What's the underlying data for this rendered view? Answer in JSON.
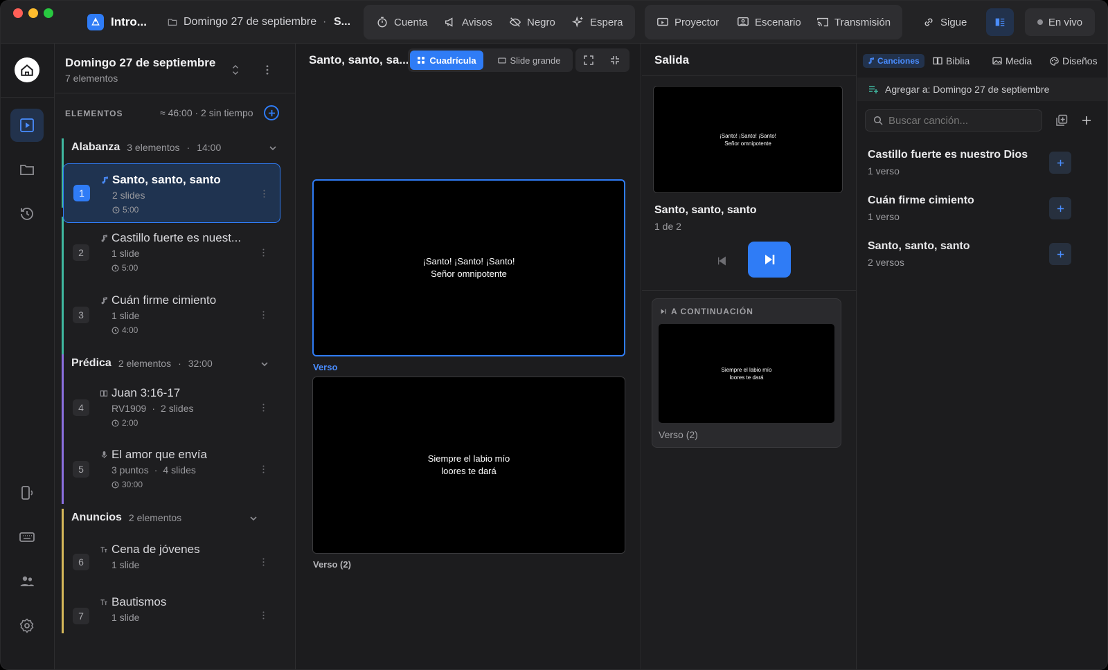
{
  "colors": {
    "accent": "#2f7cf6",
    "alabanza": "#3fb8a0",
    "predica": "#8b6fe0",
    "anuncios": "#d6b85a"
  },
  "titlebar": {
    "app_name": "Intro...",
    "service_crumb": "Domingo 27 de septiembre",
    "separator": "·",
    "crumb_tail": "S...",
    "buttons": {
      "cuenta": "Cuenta",
      "avisos": "Avisos",
      "negro": "Negro",
      "espera": "Espera",
      "proyector": "Proyector",
      "escenario": "Escenario",
      "transmision": "Transmisión",
      "sigue": "Sigue",
      "live": "En vivo"
    }
  },
  "rail": {
    "items": [
      "home-icon",
      "present-icon",
      "folder-icon",
      "history-icon",
      "remote-icon",
      "keyboard-icon",
      "people-icon",
      "gear-icon"
    ]
  },
  "service": {
    "title": "Domingo 27 de septiembre",
    "count": "7 elementos",
    "elements_label": "ELEMENTOS",
    "summary": "≈ 46:00 · 2 sin tiempo",
    "groups": [
      {
        "name": "Alabanza",
        "meta": "3 elementos",
        "dot": "·",
        "time": "14:00"
      },
      {
        "name": "Prédica",
        "meta": "2 elementos",
        "dot": "·",
        "time": "32:00"
      },
      {
        "name": "Anuncios",
        "meta": "2 elementos"
      }
    ],
    "items": [
      {
        "num": "1",
        "title": "Santo, santo, santo",
        "sub": "2 slides",
        "dur": "5:00",
        "type": "music-note-icon"
      },
      {
        "num": "2",
        "title": "Castillo fuerte es nuest...",
        "sub": "1 slide",
        "dur": "5:00",
        "type": "music-note-icon"
      },
      {
        "num": "3",
        "title": "Cuán firme cimiento",
        "sub": "1 slide",
        "dur": "4:00",
        "type": "music-note-icon"
      },
      {
        "num": "4",
        "title": "Juan 3:16-17",
        "sub_a": "RV1909",
        "dot": "·",
        "sub_b": "2 slides",
        "dur": "2:00",
        "type": "book-icon"
      },
      {
        "num": "5",
        "title": "El amor que envía",
        "sub_a": "3 puntos",
        "dot": "·",
        "sub_b": "4 slides",
        "dur": "30:00",
        "type": "microphone-icon"
      },
      {
        "num": "6",
        "title": "Cena de jóvenes",
        "sub": "1 slide",
        "type": "text-icon"
      },
      {
        "num": "7",
        "title": "Bautismos",
        "sub": "1 slide",
        "type": "text-icon"
      }
    ]
  },
  "slides_panel": {
    "title": "Santo, santo, sa...",
    "view_grid": "Cuadrícula",
    "view_big": "Slide grande",
    "slides": [
      {
        "text": "¡Santo! ¡Santo! ¡Santo!\nSeñor omnipotente",
        "label": "Verso"
      },
      {
        "text": "Siempre el labio mío\nloores te dará",
        "label": "Verso (2)"
      }
    ]
  },
  "output": {
    "title": "Salida",
    "preview_text": "¡Santo! ¡Santo! ¡Santo!\nSeñor omnipotente",
    "song": "Santo, santo, santo",
    "position": "1 de 2",
    "next_label": "A CONTINUACIÓN",
    "next_text": "Siempre el labio mío\nloores te dará",
    "next_caption": "Verso (2)"
  },
  "library": {
    "tabs": {
      "canciones": "Canciones",
      "biblia": "Biblia",
      "media": "Media",
      "disenos": "Diseños"
    },
    "add_to": "Agregar a: Domingo 27 de septiembre",
    "search_placeholder": "Buscar canción...",
    "songs": [
      {
        "title": "Castillo fuerte es nuestro Dios",
        "sub": "1 verso"
      },
      {
        "title": "Cuán firme cimiento",
        "sub": "1 verso"
      },
      {
        "title": "Santo, santo, santo",
        "sub": "2 versos"
      }
    ]
  }
}
